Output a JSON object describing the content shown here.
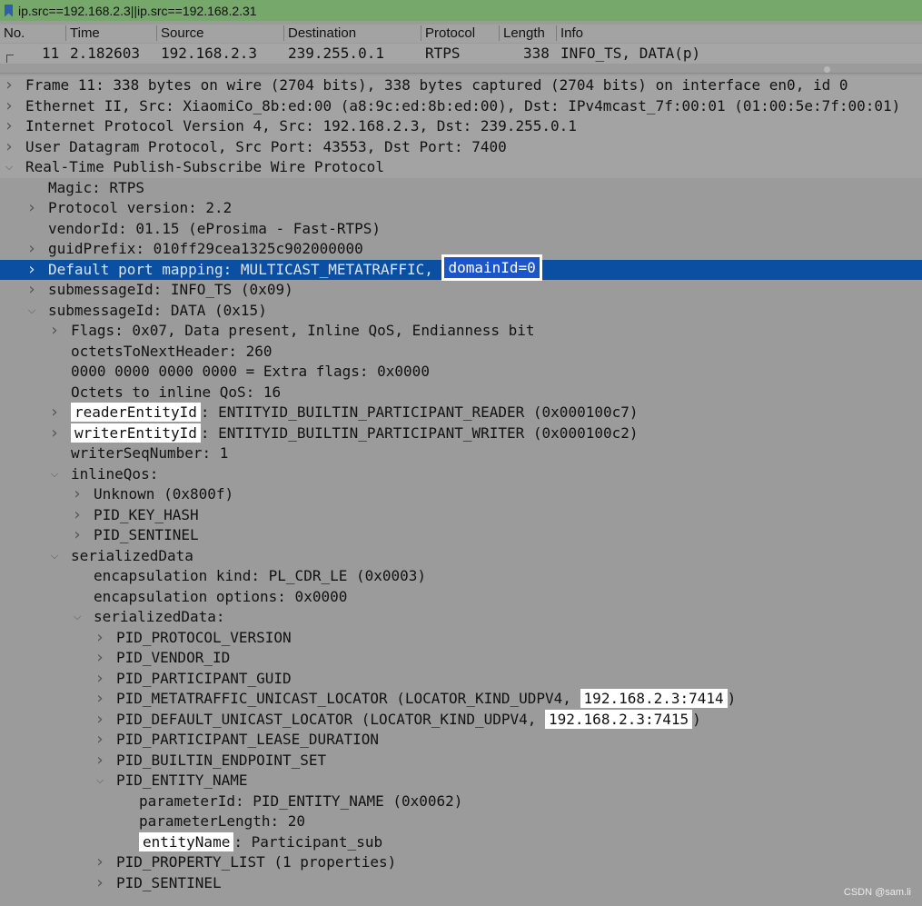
{
  "filter": {
    "value": "ip.src==192.168.2.3||ip.src==192.168.2.31"
  },
  "columns": [
    "No.",
    "Time",
    "Source",
    "Destination",
    "Protocol",
    "Length",
    "Info"
  ],
  "packet": {
    "no": "11",
    "time": "2.182603",
    "source": "192.168.2.3",
    "destination": "239.255.0.1",
    "protocol": "RTPS",
    "length": "338",
    "info": "INFO_TS, DATA(p)"
  },
  "tree": [
    {
      "indent": 0,
      "arrow": "collapsed",
      "text": "Frame 11: 338 bytes on wire (2704 bits), 338 bytes captured (2704 bits) on interface en0, id 0",
      "top": true
    },
    {
      "indent": 0,
      "arrow": "collapsed",
      "text": "Ethernet II, Src: XiaomiCo_8b:ed:00 (a8:9c:ed:8b:ed:00), Dst: IPv4mcast_7f:00:01 (01:00:5e:7f:00:01)",
      "top": true
    },
    {
      "indent": 0,
      "arrow": "collapsed",
      "text": "Internet Protocol Version 4, Src: 192.168.2.3, Dst: 239.255.0.1",
      "top": true
    },
    {
      "indent": 0,
      "arrow": "collapsed",
      "text": "User Datagram Protocol, Src Port: 43553, Dst Port: 7400",
      "top": true
    },
    {
      "indent": 0,
      "arrow": "expanded",
      "text": "Real-Time Publish-Subscribe Wire Protocol",
      "top": true
    },
    {
      "indent": 1,
      "arrow": "none",
      "text": "Magic: RTPS"
    },
    {
      "indent": 1,
      "arrow": "collapsed",
      "text": "Protocol version: 2.2"
    },
    {
      "indent": 1,
      "arrow": "none",
      "text": "vendorId: 01.15 (eProsima - Fast-RTPS)"
    },
    {
      "indent": 1,
      "arrow": "collapsed",
      "text": "guidPrefix: 010ff29cea1325c902000000"
    },
    {
      "indent": 1,
      "arrow": "collapsed",
      "text": "Default port mapping: MULTICAST_METATRAFFIC, ",
      "hl": "domainId=0",
      "hl_pos": "after",
      "selected": true
    },
    {
      "indent": 1,
      "arrow": "collapsed",
      "text": "submessageId: INFO_TS (0x09)"
    },
    {
      "indent": 1,
      "arrow": "expanded",
      "text": "submessageId: DATA (0x15)"
    },
    {
      "indent": 2,
      "arrow": "collapsed",
      "text": "Flags: 0x07, Data present, Inline QoS, Endianness bit"
    },
    {
      "indent": 2,
      "arrow": "none",
      "text": "octetsToNextHeader: 260"
    },
    {
      "indent": 2,
      "arrow": "none",
      "text": "0000 0000 0000 0000 = Extra flags: 0x0000"
    },
    {
      "indent": 2,
      "arrow": "none",
      "text": "Octets to inline QoS: 16"
    },
    {
      "indent": 2,
      "arrow": "collapsed",
      "hl": "readerEntityId",
      "hl_pos": "before",
      "text": ": ENTITYID_BUILTIN_PARTICIPANT_READER (0x000100c7)"
    },
    {
      "indent": 2,
      "arrow": "collapsed",
      "hl": "writerEntityId",
      "hl_pos": "before",
      "text": ": ENTITYID_BUILTIN_PARTICIPANT_WRITER (0x000100c2)"
    },
    {
      "indent": 2,
      "arrow": "none",
      "text": "writerSeqNumber: 1"
    },
    {
      "indent": 2,
      "arrow": "expanded",
      "text": "inlineQos:"
    },
    {
      "indent": 3,
      "arrow": "collapsed",
      "text": "Unknown (0x800f)"
    },
    {
      "indent": 3,
      "arrow": "collapsed",
      "text": "PID_KEY_HASH"
    },
    {
      "indent": 3,
      "arrow": "collapsed",
      "text": "PID_SENTINEL"
    },
    {
      "indent": 2,
      "arrow": "expanded",
      "text": "serializedData"
    },
    {
      "indent": 3,
      "arrow": "none",
      "text": "encapsulation kind: PL_CDR_LE (0x0003)"
    },
    {
      "indent": 3,
      "arrow": "none",
      "text": "encapsulation options: 0x0000"
    },
    {
      "indent": 3,
      "arrow": "expanded",
      "text": "serializedData:"
    },
    {
      "indent": 4,
      "arrow": "collapsed",
      "text": "PID_PROTOCOL_VERSION"
    },
    {
      "indent": 4,
      "arrow": "collapsed",
      "text": "PID_VENDOR_ID"
    },
    {
      "indent": 4,
      "arrow": "collapsed",
      "text": "PID_PARTICIPANT_GUID"
    },
    {
      "indent": 4,
      "arrow": "collapsed",
      "text": "PID_METATRAFFIC_UNICAST_LOCATOR (LOCATOR_KIND_UDPV4, ",
      "hl": "192.168.2.3:7414",
      "hl_pos": "after",
      "tail": ")"
    },
    {
      "indent": 4,
      "arrow": "collapsed",
      "text": "PID_DEFAULT_UNICAST_LOCATOR (LOCATOR_KIND_UDPV4, ",
      "hl": "192.168.2.3:7415",
      "hl_pos": "after",
      "tail": ")"
    },
    {
      "indent": 4,
      "arrow": "collapsed",
      "text": "PID_PARTICIPANT_LEASE_DURATION"
    },
    {
      "indent": 4,
      "arrow": "collapsed",
      "text": "PID_BUILTIN_ENDPOINT_SET"
    },
    {
      "indent": 4,
      "arrow": "expanded",
      "text": "PID_ENTITY_NAME"
    },
    {
      "indent": 5,
      "arrow": "none",
      "text": "parameterId: PID_ENTITY_NAME (0x0062)"
    },
    {
      "indent": 5,
      "arrow": "none",
      "text": "parameterLength: 20"
    },
    {
      "indent": 5,
      "arrow": "none",
      "hl": "entityName",
      "hl_pos": "before",
      "text": ": Participant_sub"
    },
    {
      "indent": 4,
      "arrow": "collapsed",
      "text": "PID_PROPERTY_LIST (1 properties)"
    },
    {
      "indent": 4,
      "arrow": "collapsed",
      "text": "PID_SENTINEL"
    }
  ],
  "watermark": "CSDN @sam.li"
}
